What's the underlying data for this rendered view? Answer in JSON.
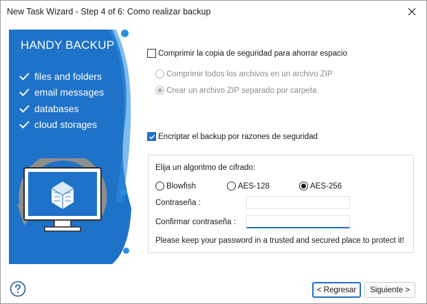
{
  "window": {
    "title": "New Task Wizard - Step 4 of 6: Como realizar backup",
    "close_icon": "close-icon"
  },
  "banner": {
    "brand": "HANDY BACKUP",
    "features": [
      "files and folders",
      "email messages",
      "databases",
      "cloud storages"
    ],
    "colors": {
      "primary": "#1e72c8",
      "light": "#2a8ee0",
      "gray": "#8e8e8e"
    }
  },
  "compress": {
    "checkbox_label": "Comprimir la copia de seguridad para ahorrar espacio",
    "checked": false,
    "options": [
      {
        "label": "Comprimir todos los archivos en un archivo ZIP",
        "selected": false,
        "enabled": false
      },
      {
        "label": "Crear un archivo ZIP separado por carpeta",
        "selected": true,
        "enabled": false
      }
    ]
  },
  "encrypt": {
    "checkbox_label": "Encriptar el backup por razones de seguridad",
    "checked": true,
    "algorithm_label": "Elija un algoritmo de cifrado:",
    "algorithms": [
      {
        "label": "Blowfish",
        "selected": false
      },
      {
        "label": "AES-128",
        "selected": false
      },
      {
        "label": "AES-256",
        "selected": true
      }
    ],
    "password_label": "Contraseña :",
    "password_value": "",
    "confirm_label": "Confirmar contraseña :",
    "confirm_value": "",
    "note": "Please keep your password in a trusted and secured place to protect it!"
  },
  "footer": {
    "help_icon": "help-icon",
    "back_label": "< Regresar",
    "next_label": "Siguiente >"
  },
  "accent_color": "#1f6fc6"
}
